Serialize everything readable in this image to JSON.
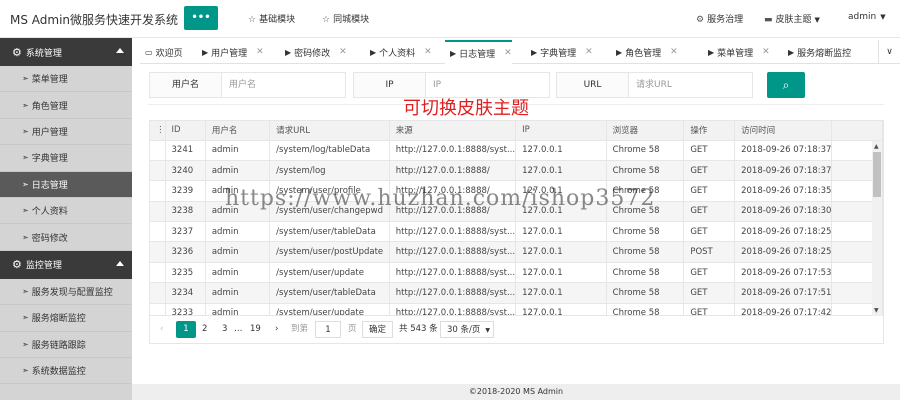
{
  "header": {
    "title": "MS Admin微服务快速开发系统",
    "menu_icon": "dots-icon",
    "nav": [
      {
        "icon": "star-icon",
        "label": "基础模块"
      },
      {
        "icon": "star-icon",
        "label": "同城模块"
      }
    ],
    "right": [
      {
        "icon": "gear-icon",
        "label": "服务治理"
      },
      {
        "icon": "keyboard-icon",
        "label": "皮肤主题"
      },
      {
        "icon": "user-icon",
        "label": "admin"
      }
    ]
  },
  "sidebar": {
    "groups": [
      {
        "title": "系统管理",
        "items": [
          "菜单管理",
          "角色管理",
          "用户管理",
          "字典管理",
          "日志管理",
          "个人资料",
          "密码修改"
        ]
      },
      {
        "title": "监控管理",
        "items": [
          "服务发现与配置监控",
          "服务熔断监控",
          "服务链路跟踪",
          "系统数据监控"
        ]
      }
    ],
    "active": "日志管理"
  },
  "tabs": {
    "items": [
      "欢迎页",
      "用户管理",
      "密码修改",
      "个人资料",
      "日志管理",
      "字典管理",
      "角色管理",
      "菜单管理",
      "服务熔断监控"
    ],
    "active": "日志管理"
  },
  "search": {
    "fields": [
      {
        "label": "用户名",
        "placeholder": "用户名"
      },
      {
        "label": "IP",
        "placeholder": "IP"
      },
      {
        "label": "URL",
        "placeholder": "请求URL"
      }
    ],
    "button_icon": "search-icon"
  },
  "overlay": {
    "skin_note": "可切换皮肤主题",
    "watermark": "https://www.huzhan.com/ishop3572"
  },
  "table": {
    "columns": [
      "ID",
      "用户名",
      "请求URL",
      "来源",
      "IP",
      "浏览器",
      "操作",
      "访问时间"
    ],
    "rows": [
      [
        "3241",
        "admin",
        "/system/log/tableData",
        "http://127.0.0.1:8888/syst...",
        "127.0.0.1",
        "Chrome 58",
        "GET",
        "2018-09-26 07:18:37"
      ],
      [
        "3240",
        "admin",
        "/system/log",
        "http://127.0.0.1:8888/",
        "127.0.0.1",
        "Chrome 58",
        "GET",
        "2018-09-26 07:18:37"
      ],
      [
        "3239",
        "admin",
        "/system/user/profile",
        "http://127.0.0.1:8888/",
        "127.0.0.1",
        "Chrome 58",
        "GET",
        "2018-09-26 07:18:35"
      ],
      [
        "3238",
        "admin",
        "/system/user/changepwd",
        "http://127.0.0.1:8888/",
        "127.0.0.1",
        "Chrome 58",
        "GET",
        "2018-09-26 07:18:30"
      ],
      [
        "3237",
        "admin",
        "/system/user/tableData",
        "http://127.0.0.1:8888/syst...",
        "127.0.0.1",
        "Chrome 58",
        "GET",
        "2018-09-26 07:18:25"
      ],
      [
        "3236",
        "admin",
        "/system/user/postUpdate",
        "http://127.0.0.1:8888/syst...",
        "127.0.0.1",
        "Chrome 58",
        "POST",
        "2018-09-26 07:18:25"
      ],
      [
        "3235",
        "admin",
        "/system/user/update",
        "http://127.0.0.1:8888/syst...",
        "127.0.0.1",
        "Chrome 58",
        "GET",
        "2018-09-26 07:17:53"
      ],
      [
        "3234",
        "admin",
        "/system/user/tableData",
        "http://127.0.0.1:8888/syst...",
        "127.0.0.1",
        "Chrome 58",
        "GET",
        "2018-09-26 07:17:51"
      ],
      [
        "3233",
        "admin",
        "/system/user/update",
        "http://127.0.0.1:8888/syst...",
        "127.0.0.1",
        "Chrome 58",
        "GET",
        "2018-09-26 07:17:42"
      ]
    ]
  },
  "pagination": {
    "prev": "‹",
    "pages": [
      "1",
      "2",
      "3",
      "…",
      "19"
    ],
    "current": "1",
    "next": "›",
    "goto_label": "到第",
    "goto_value": "1",
    "page_unit": "页",
    "confirm": "确定",
    "total": "共 543 条",
    "page_size": "30 条/页"
  },
  "footer": {
    "text": "©2018-2020 MS Admin"
  },
  "colors": {
    "accent": "#009688",
    "sidebar_bg": "#d4d4d4",
    "sidebar_header": "#3a3a3a",
    "sidebar_active": "#5a5a5a"
  }
}
